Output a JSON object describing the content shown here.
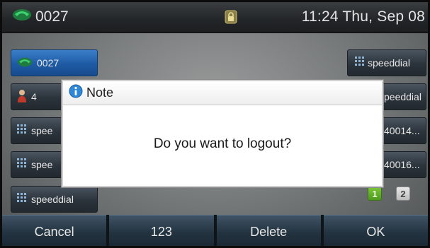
{
  "status": {
    "line": "0027",
    "datetime": "11:24 Thu, Sep 08"
  },
  "line_keys_left": [
    {
      "label": "0027",
      "icon": "phone-icon",
      "active": true
    },
    {
      "label": "4",
      "icon": "contact-icon",
      "active": false
    },
    {
      "label": "spee",
      "icon": "speeddial-icon",
      "active": false
    },
    {
      "label": "spee",
      "icon": "speeddial-icon",
      "active": false
    },
    {
      "label": "speeddial",
      "icon": "speeddial-icon",
      "active": false
    }
  ],
  "line_keys_right": [
    {
      "label": "speeddial",
      "icon": "speeddial-icon"
    },
    {
      "label": "peeddial"
    },
    {
      "label": "40014..."
    },
    {
      "label": "40016..."
    }
  ],
  "pager": {
    "page1": "1",
    "page2": "2"
  },
  "dialog": {
    "title": "Note",
    "message": "Do you want to logout?"
  },
  "softkeys": {
    "cancel": "Cancel",
    "num": "123",
    "delete": "Delete",
    "ok": "OK"
  },
  "colors": {
    "active_key": "#1e5aa4",
    "phone_icon": "#2fb35a",
    "page_active": "#5aa822"
  }
}
